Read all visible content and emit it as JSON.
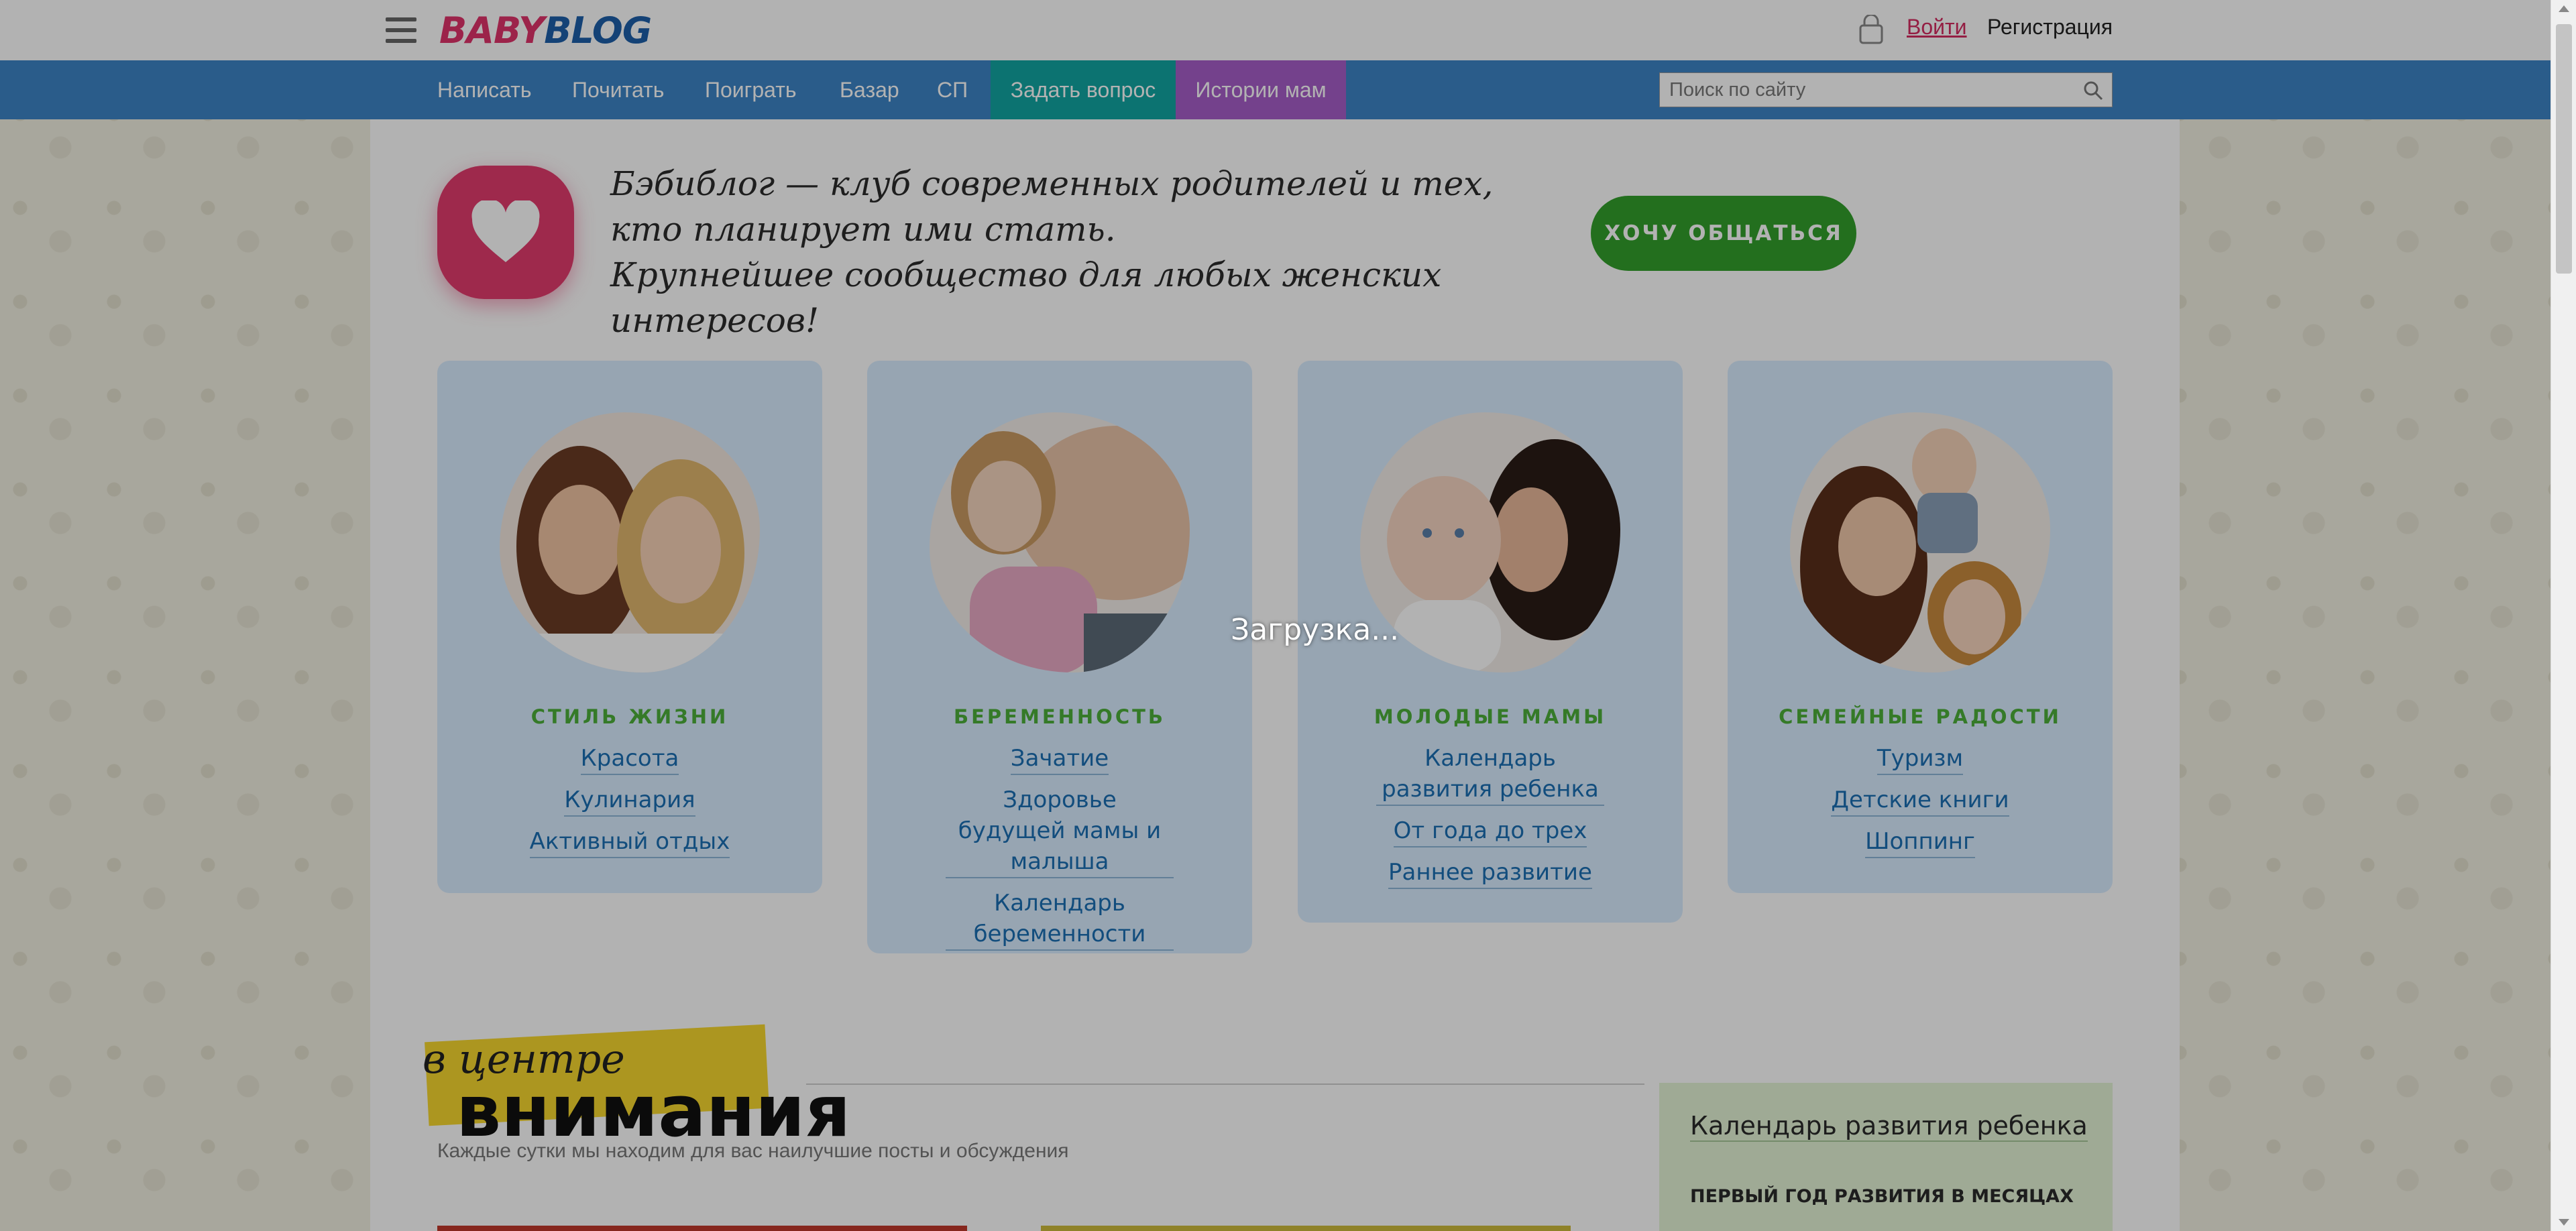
{
  "header": {
    "logo_part1": "BABY",
    "logo_part2": "BLOG",
    "menu_icon": "hamburger-icon",
    "cart_icon": "bag-icon",
    "login": "Войти",
    "register": "Регистрация",
    "search_placeholder": "Поиск по сайту"
  },
  "nav": {
    "items": [
      {
        "label": "Написать"
      },
      {
        "label": "Почитать"
      },
      {
        "label": "Поиграть"
      },
      {
        "label": "Базар"
      },
      {
        "label": "СП"
      },
      {
        "label": "Задать вопрос"
      },
      {
        "label": "Истории мам"
      }
    ]
  },
  "intro": {
    "line1": "Бэбиблог — клуб современных родителей и тех, кто планирует ими стать.",
    "line2": "Крупнейшее сообщество для любых женских интересов!",
    "cta": "ХОЧУ ОБЩАТЬСЯ"
  },
  "categories": [
    {
      "title": "СТИЛЬ ЖИЗНИ",
      "links": [
        "Красота",
        "Кулинария",
        "Активный отдых"
      ]
    },
    {
      "title": "БЕРЕМЕННОСТЬ",
      "links": [
        "Зачатие",
        "Здоровье будущей мамы и малыша",
        "Календарь беременности"
      ]
    },
    {
      "title": "МОЛОДЫЕ МАМЫ",
      "links": [
        "Календарь развития ребенка",
        "От года до трех",
        "Раннее развитие"
      ]
    },
    {
      "title": "СЕМЕЙНЫЕ РАДОСТИ",
      "links": [
        "Туризм",
        "Детские книги",
        "Шоппинг"
      ]
    }
  ],
  "overlay": {
    "loading_text": "Загрузка..."
  },
  "focus": {
    "small": "в центре",
    "large": "внимания",
    "subtitle": "Каждые сутки мы находим для вас наилучшие посты и обсуждения"
  },
  "calendar_widget": {
    "title": "Календарь развития ребенка",
    "subtitle": "ПЕРВЫЙ ГОД РАЗВИТИЯ В МЕСЯЦАХ"
  },
  "colors": {
    "accent_blue": "#3d85c6",
    "accent_teal": "#12a5a3",
    "accent_purple": "#a75ec9",
    "brand_pink": "#e23c6e",
    "cta_green": "#33a02c"
  }
}
